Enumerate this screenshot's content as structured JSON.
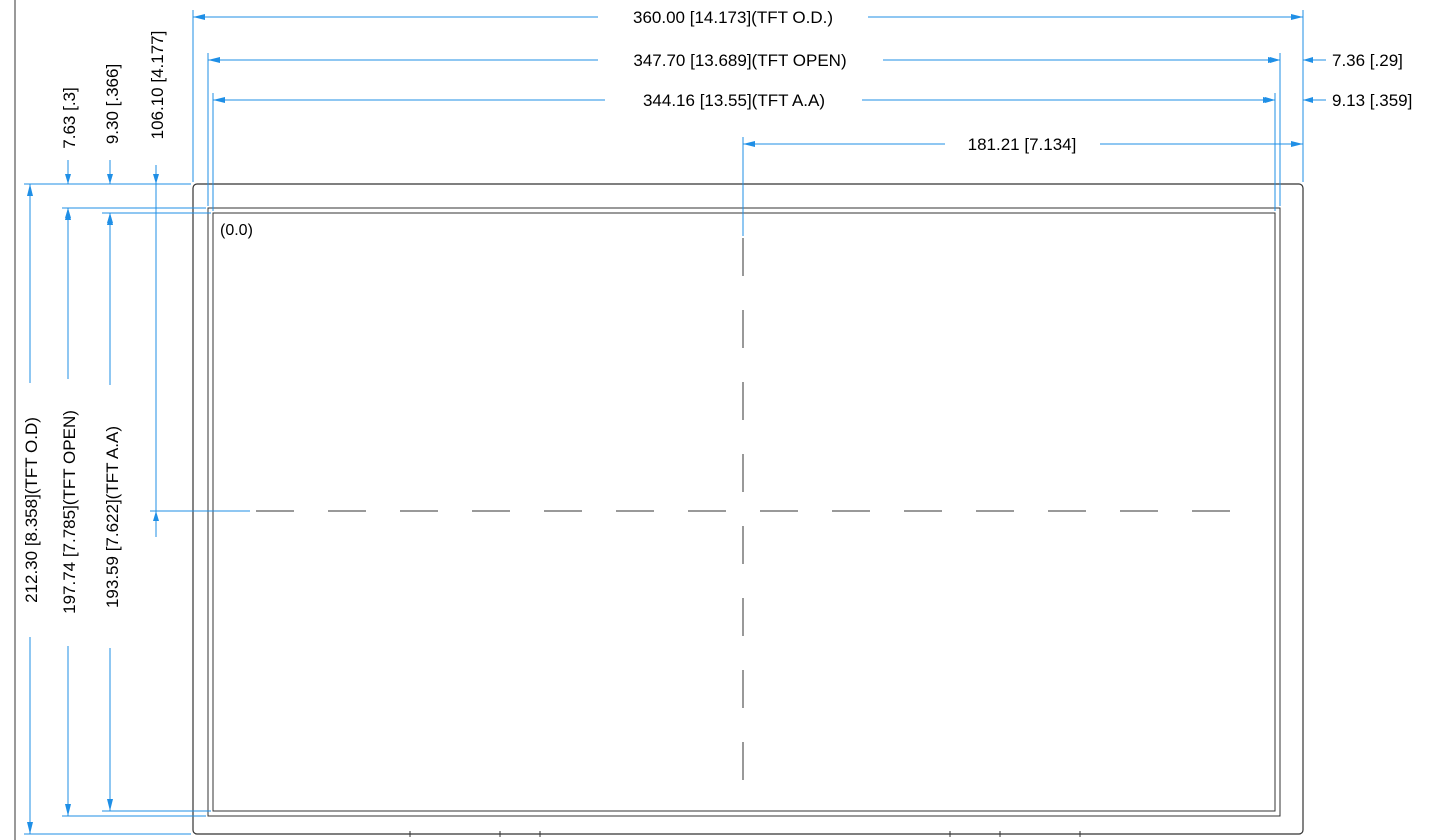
{
  "dimensions": {
    "width_od": "360.00 [14.173](TFT O.D.)",
    "width_open": "347.70 [13.689](TFT OPEN)",
    "width_aa": "344.16 [13.55](TFT A.A)",
    "offset_open_right": "7.36 [.29]",
    "offset_aa_right": "9.13 [.359]",
    "center_x": "181.21 [7.134]",
    "offset_open_top": "7.63 [.3]",
    "offset_aa_top": "9.30 [.366]",
    "center_y": "106.10 [4.177]",
    "height_od": "212.30 [8.358](TFT O.D)",
    "height_open": "197.74 [7.785](TFT OPEN)",
    "height_aa": "193.59 [7.622](TFT A.A)"
  },
  "origin_label": "(0.0)",
  "colors": {
    "dimension": "#1f8fe6",
    "outline": "#333333"
  }
}
